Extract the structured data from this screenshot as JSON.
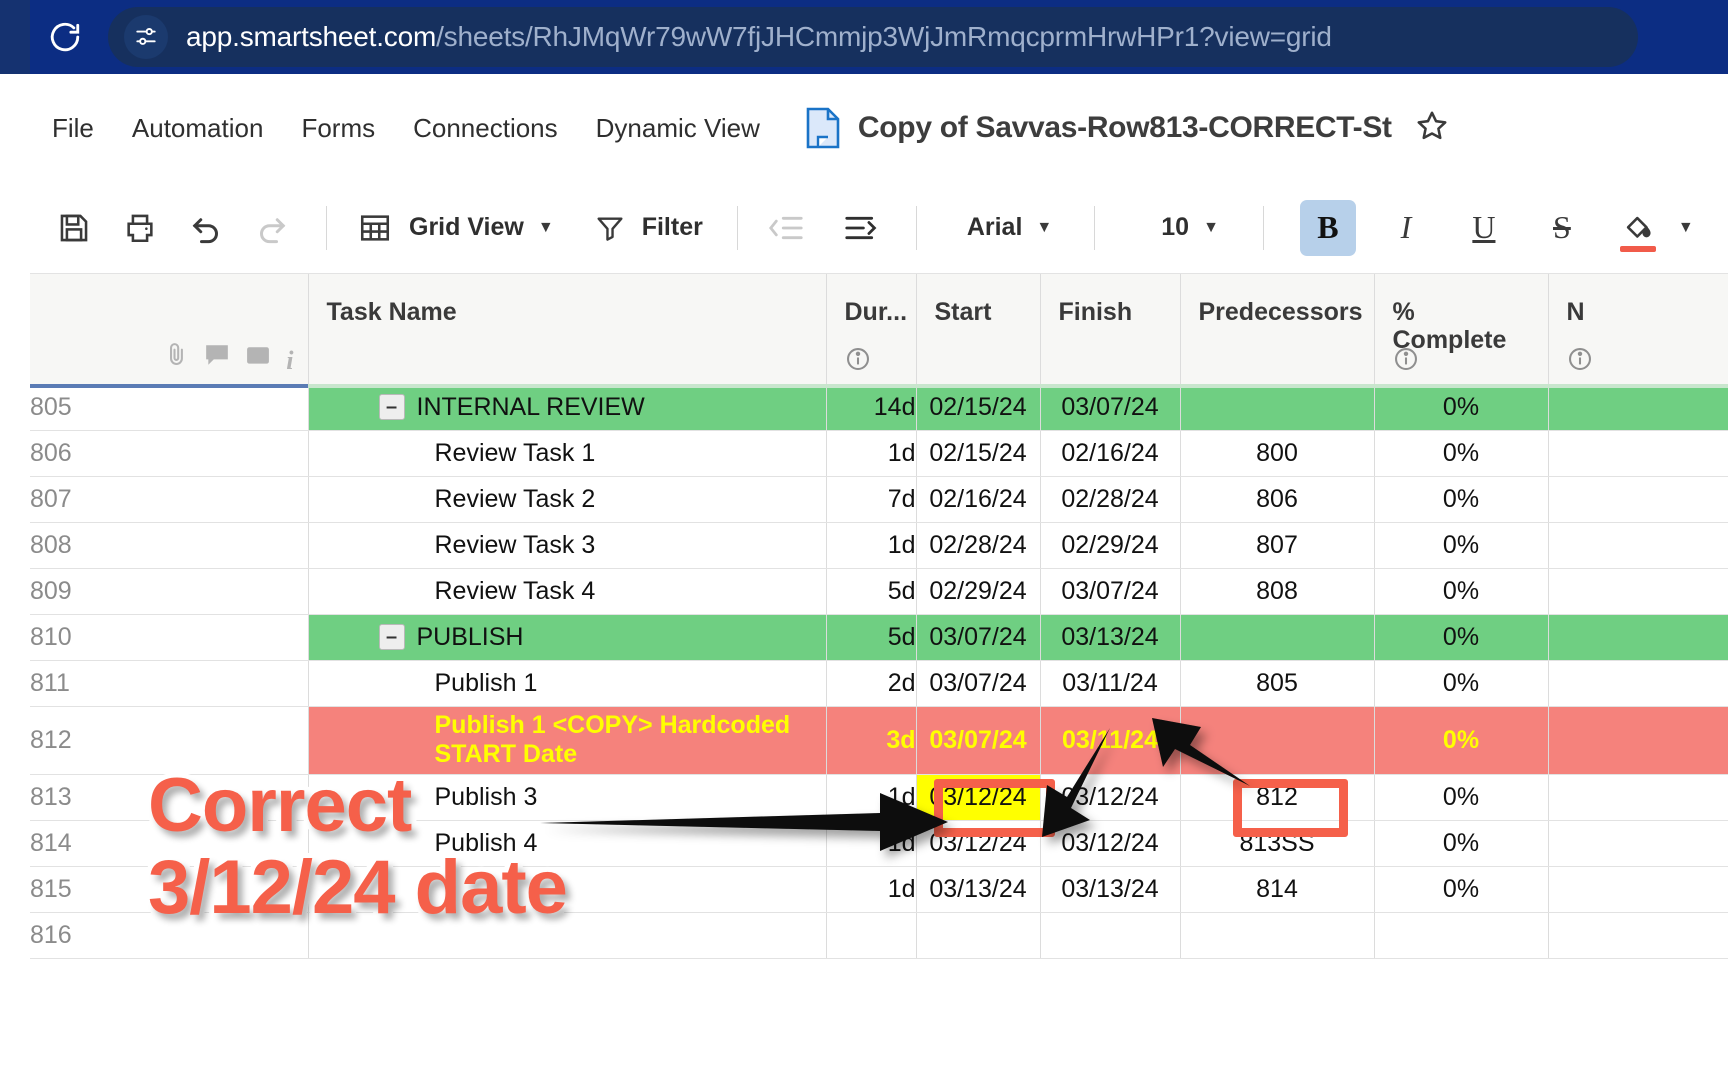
{
  "browser": {
    "reload_icon": "reload-icon",
    "site_info_icon": "site-settings-icon",
    "url_host": "app.smartsheet.com",
    "url_path": "/sheets/RhJMqWr79wW7fjJHCmmjp3WjJmRmqcprmHrwHPr1?view=grid",
    "bar_color": "#0c2d83"
  },
  "menu": {
    "items": [
      {
        "label": "File"
      },
      {
        "label": "Automation"
      },
      {
        "label": "Forms"
      },
      {
        "label": "Connections"
      },
      {
        "label": "Dynamic View"
      }
    ],
    "doc_icon": "sheet-document-icon",
    "doc_title": "Copy of Savvas-Row813-CORRECT-St",
    "star_icon": "star-favorite-icon"
  },
  "toolbar": {
    "save_icon": "save-icon",
    "print_icon": "print-icon",
    "undo_icon": "undo-icon",
    "redo_icon": "redo-icon",
    "grid_icon": "grid-table-icon",
    "grid_view_label": "Grid View",
    "grid_view_caret": "▼",
    "filter_icon": "filter-funnel-icon",
    "filter_label": "Filter",
    "outdent_icon": "outdent-icon",
    "indent_icon": "indent-icon",
    "font_family_label": "Arial",
    "font_family_caret": "▼",
    "font_size_label": "10",
    "font_size_caret": "▼",
    "bold_label": "B",
    "italic_label": "I",
    "underline_label": "U",
    "strike_label": "S",
    "fill_color_icon": "fill-color-icon",
    "fill_color_swatch": "#f15b4a",
    "more_caret": "▼",
    "bold_active_bg": "#b7d0ea"
  },
  "grid": {
    "headers": {
      "rownum": "",
      "task_name": "Task Name",
      "duration": "Dur...",
      "start": "Start",
      "finish": "Finish",
      "predecessors": "Predecessors",
      "pct_complete": "%\nComplete",
      "next": "N"
    },
    "header_icons": [
      "attachment-icon",
      "comment-icon",
      "proof-icon",
      "info-italic-icon"
    ],
    "column_info_icons": [
      "duration-info-icon",
      "pct-complete-info-icon",
      "next-info-icon"
    ],
    "rows": [
      {
        "num": "805",
        "task": "INTERNAL REVIEW",
        "dur": "14d",
        "start": "02/15/24",
        "finish": "03/07/24",
        "pred": "",
        "pct": "0%",
        "style": "green",
        "group": true
      },
      {
        "num": "806",
        "task": "Review Task 1",
        "dur": "1d",
        "start": "02/15/24",
        "finish": "02/16/24",
        "pred": "800",
        "pct": "0%",
        "style": "plain",
        "group": false
      },
      {
        "num": "807",
        "task": "Review Task 2",
        "dur": "7d",
        "start": "02/16/24",
        "finish": "02/28/24",
        "pred": "806",
        "pct": "0%",
        "style": "plain",
        "group": false
      },
      {
        "num": "808",
        "task": "Review Task 3",
        "dur": "1d",
        "start": "02/28/24",
        "finish": "02/29/24",
        "pred": "807",
        "pct": "0%",
        "style": "plain",
        "group": false
      },
      {
        "num": "809",
        "task": "Review Task 4",
        "dur": "5d",
        "start": "02/29/24",
        "finish": "03/07/24",
        "pred": "808",
        "pct": "0%",
        "style": "plain",
        "group": false
      },
      {
        "num": "810",
        "task": "PUBLISH",
        "dur": "5d",
        "start": "03/07/24",
        "finish": "03/13/24",
        "pred": "",
        "pct": "0%",
        "style": "green",
        "group": true
      },
      {
        "num": "811",
        "task": "Publish 1",
        "dur": "2d",
        "start": "03/07/24",
        "finish": "03/11/24",
        "pred": "805",
        "pct": "0%",
        "style": "plain",
        "group": false
      },
      {
        "num": "812",
        "task": "Publish 1 <COPY> Hardcoded START Date",
        "dur": "3d",
        "start": "03/07/24",
        "finish": "03/11/24",
        "pred": "",
        "pct": "0%",
        "style": "red",
        "group": false
      },
      {
        "num": "813",
        "task": "Publish 3",
        "dur": "1d",
        "start": "03/12/24",
        "finish": "03/12/24",
        "pred": "812",
        "pct": "0%",
        "style": "plain",
        "group": false
      },
      {
        "num": "814",
        "task": "Publish 4",
        "dur": "1d",
        "start": "03/12/24",
        "finish": "03/12/24",
        "pred": "813SS",
        "pct": "0%",
        "style": "plain",
        "group": false
      },
      {
        "num": "815",
        "task": "",
        "dur": "1d",
        "start": "03/13/24",
        "finish": "03/13/24",
        "pred": "814",
        "pct": "0%",
        "style": "plain",
        "group": false
      },
      {
        "num": "816",
        "task": "",
        "dur": "",
        "start": "",
        "finish": "",
        "pred": "",
        "pct": "",
        "style": "plain",
        "group": false
      }
    ],
    "collapse_glyph": "–",
    "colors": {
      "group_green": "#6fcf82",
      "alert_red": "#f5827c",
      "alert_text_yellow": "#ffff00",
      "highlight_yellow": "#ffff00",
      "annotation_red": "#f5604a"
    }
  },
  "annotations": {
    "callout_line1": "Correct",
    "callout_line2": "3/12/24 date",
    "arrow_to_start_cell": "arrow-right-icon",
    "arrow_to_finish_cell": "arrow-up-left-icon",
    "arrow_to_predecessor_cell": "arrow-up-right-icon",
    "highlight_box_start": "red-outline-box",
    "highlight_box_pred": "red-outline-box"
  }
}
